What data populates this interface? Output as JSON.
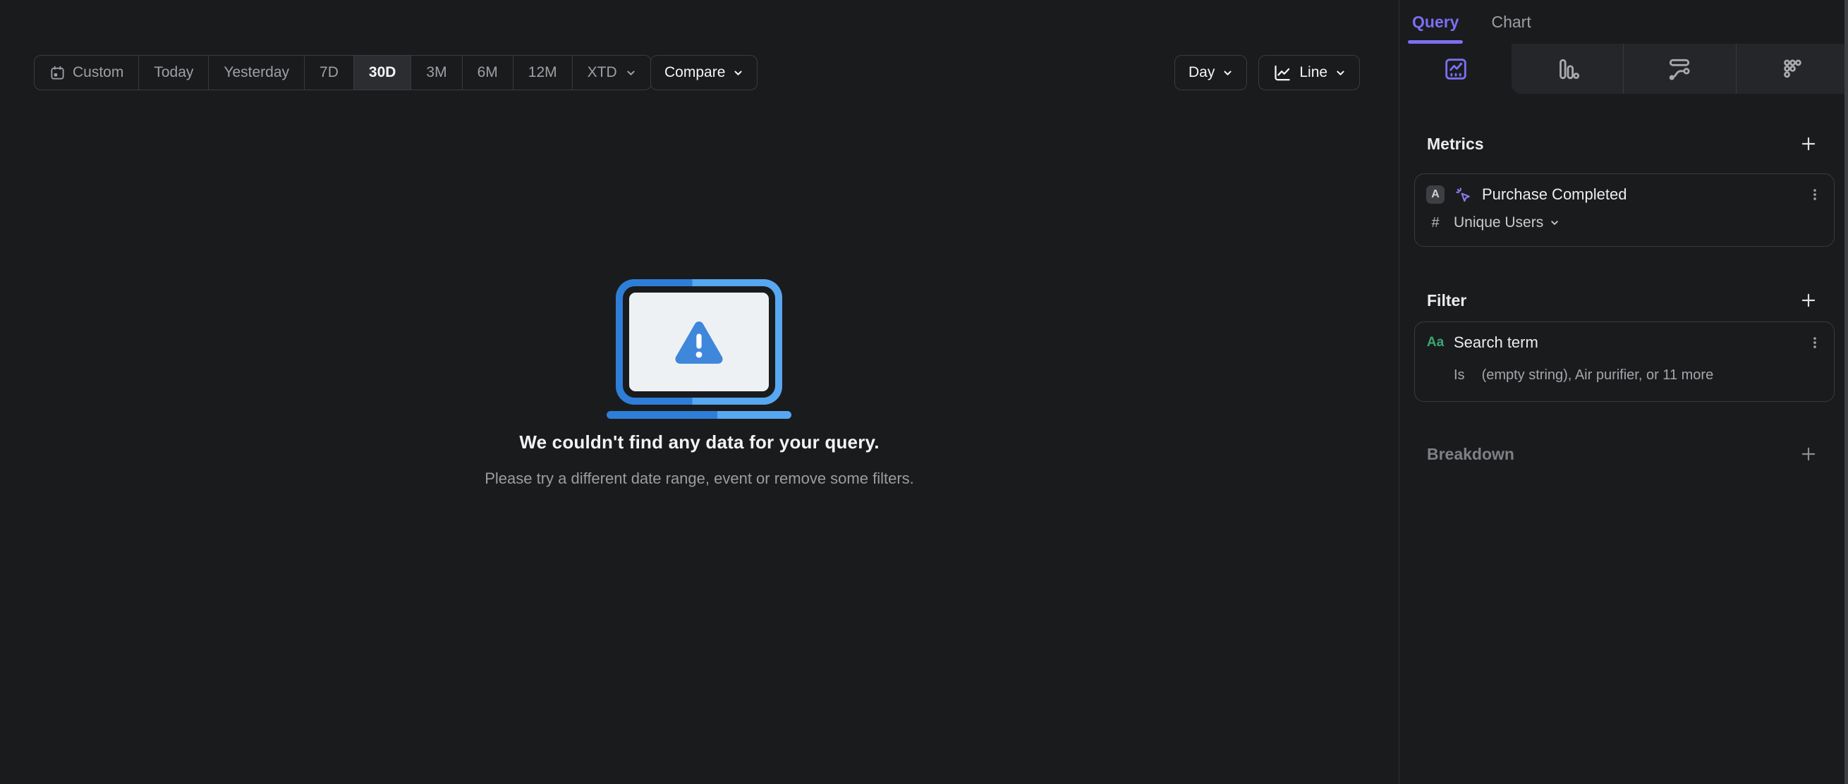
{
  "toolbar": {
    "date_ranges": [
      {
        "label": "Custom",
        "icon": "calendar-icon"
      },
      {
        "label": "Today"
      },
      {
        "label": "Yesterday"
      },
      {
        "label": "7D"
      },
      {
        "label": "30D",
        "active": true
      },
      {
        "label": "3M"
      },
      {
        "label": "6M"
      },
      {
        "label": "12M"
      },
      {
        "label": "XTD",
        "has_chevron": true
      }
    ],
    "compare_label": "Compare",
    "interval_label": "Day",
    "chart_type_label": "Line",
    "chart_type_icon": "line-chart-icon"
  },
  "empty_state": {
    "title": "We couldn't find any data for your query.",
    "subtitle": "Please try a different date range, event or remove some filters.",
    "illustration": "monitor-warning-icon"
  },
  "sidebar": {
    "tabs": [
      {
        "label": "Query",
        "active": true
      },
      {
        "label": "Chart",
        "active": false
      }
    ],
    "icon_tabs": [
      "insights-icon",
      "funnels-icon",
      "flows-icon",
      "retention-icon"
    ],
    "metrics": {
      "heading": "Metrics",
      "add_icon": "plus-icon",
      "items": [
        {
          "letter": "A",
          "icon": "event-click-icon",
          "event": "Purchase Completed",
          "aggregation_prefix": "#",
          "aggregation": "Unique Users",
          "menu_icon": "kebab-icon"
        }
      ]
    },
    "filter": {
      "heading": "Filter",
      "add_icon": "plus-icon",
      "items": [
        {
          "type_badge": "Aa",
          "property": "Search term",
          "operator": "Is",
          "values": "(empty string), Air purifier, or 11 more",
          "menu_icon": "kebab-icon"
        }
      ]
    },
    "breakdown": {
      "heading": "Breakdown",
      "add_icon": "plus-icon"
    }
  },
  "colors": {
    "background": "#1a1b1d",
    "accent_purple": "#7b6ff2",
    "green_type_badge": "#36a873",
    "blue_dark": "#2e7ed8",
    "blue_light": "#58a7f1",
    "warning_triangle_blue": "#3e87da",
    "border": "#3a3b3e",
    "tab_group_bg": "#242629",
    "selected_segment_bg": "#2b2d31"
  }
}
